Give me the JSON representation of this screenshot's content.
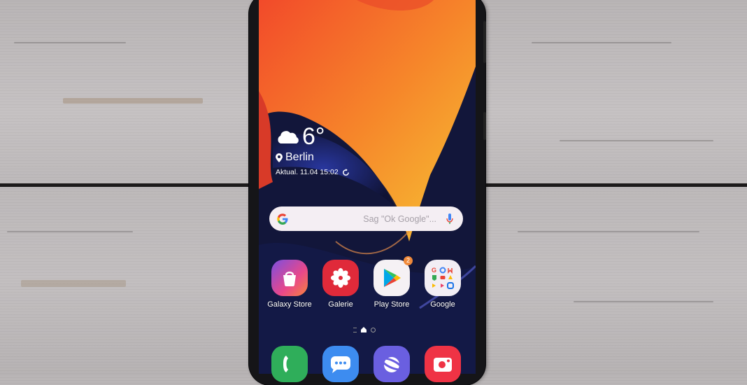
{
  "weather": {
    "icon": "cloud-icon",
    "temperature": "6°",
    "location": "Berlin",
    "updated": "Aktual. 11.04 15:02",
    "refresh_icon": "refresh-icon"
  },
  "search": {
    "logo": "google-g-icon",
    "placeholder": "Sag \"Ok Google\"...",
    "mic_icon": "microphone-icon"
  },
  "apps": [
    {
      "label": "Galaxy Store",
      "icon": "shopping-bag-icon"
    },
    {
      "label": "Galerie",
      "icon": "flower-icon"
    },
    {
      "label": "Play Store",
      "icon": "play-triangle-icon",
      "badge": "2"
    },
    {
      "label": "Google",
      "icon": "folder-grid-icon"
    }
  ],
  "page_indicator": {
    "pages": 2,
    "current": 1,
    "home_icon": "home-icon"
  },
  "dock": [
    {
      "name": "Phone",
      "icon": "phone-icon"
    },
    {
      "name": "Messages",
      "icon": "chat-bubble-icon"
    },
    {
      "name": "Internet",
      "icon": "planet-icon"
    },
    {
      "name": "Camera",
      "icon": "camera-icon"
    }
  ],
  "colors": {
    "galaxy_store": "#e9488a",
    "galerie": "#e02a3a",
    "play_store_bg": "#f5f1f4",
    "google_folder": "#f2eef4",
    "phone": "#2fae5a",
    "messages": "#3d8cf0",
    "internet": "#6a5fe0",
    "camera": "#ef3345",
    "badge": "#f08a3a"
  }
}
